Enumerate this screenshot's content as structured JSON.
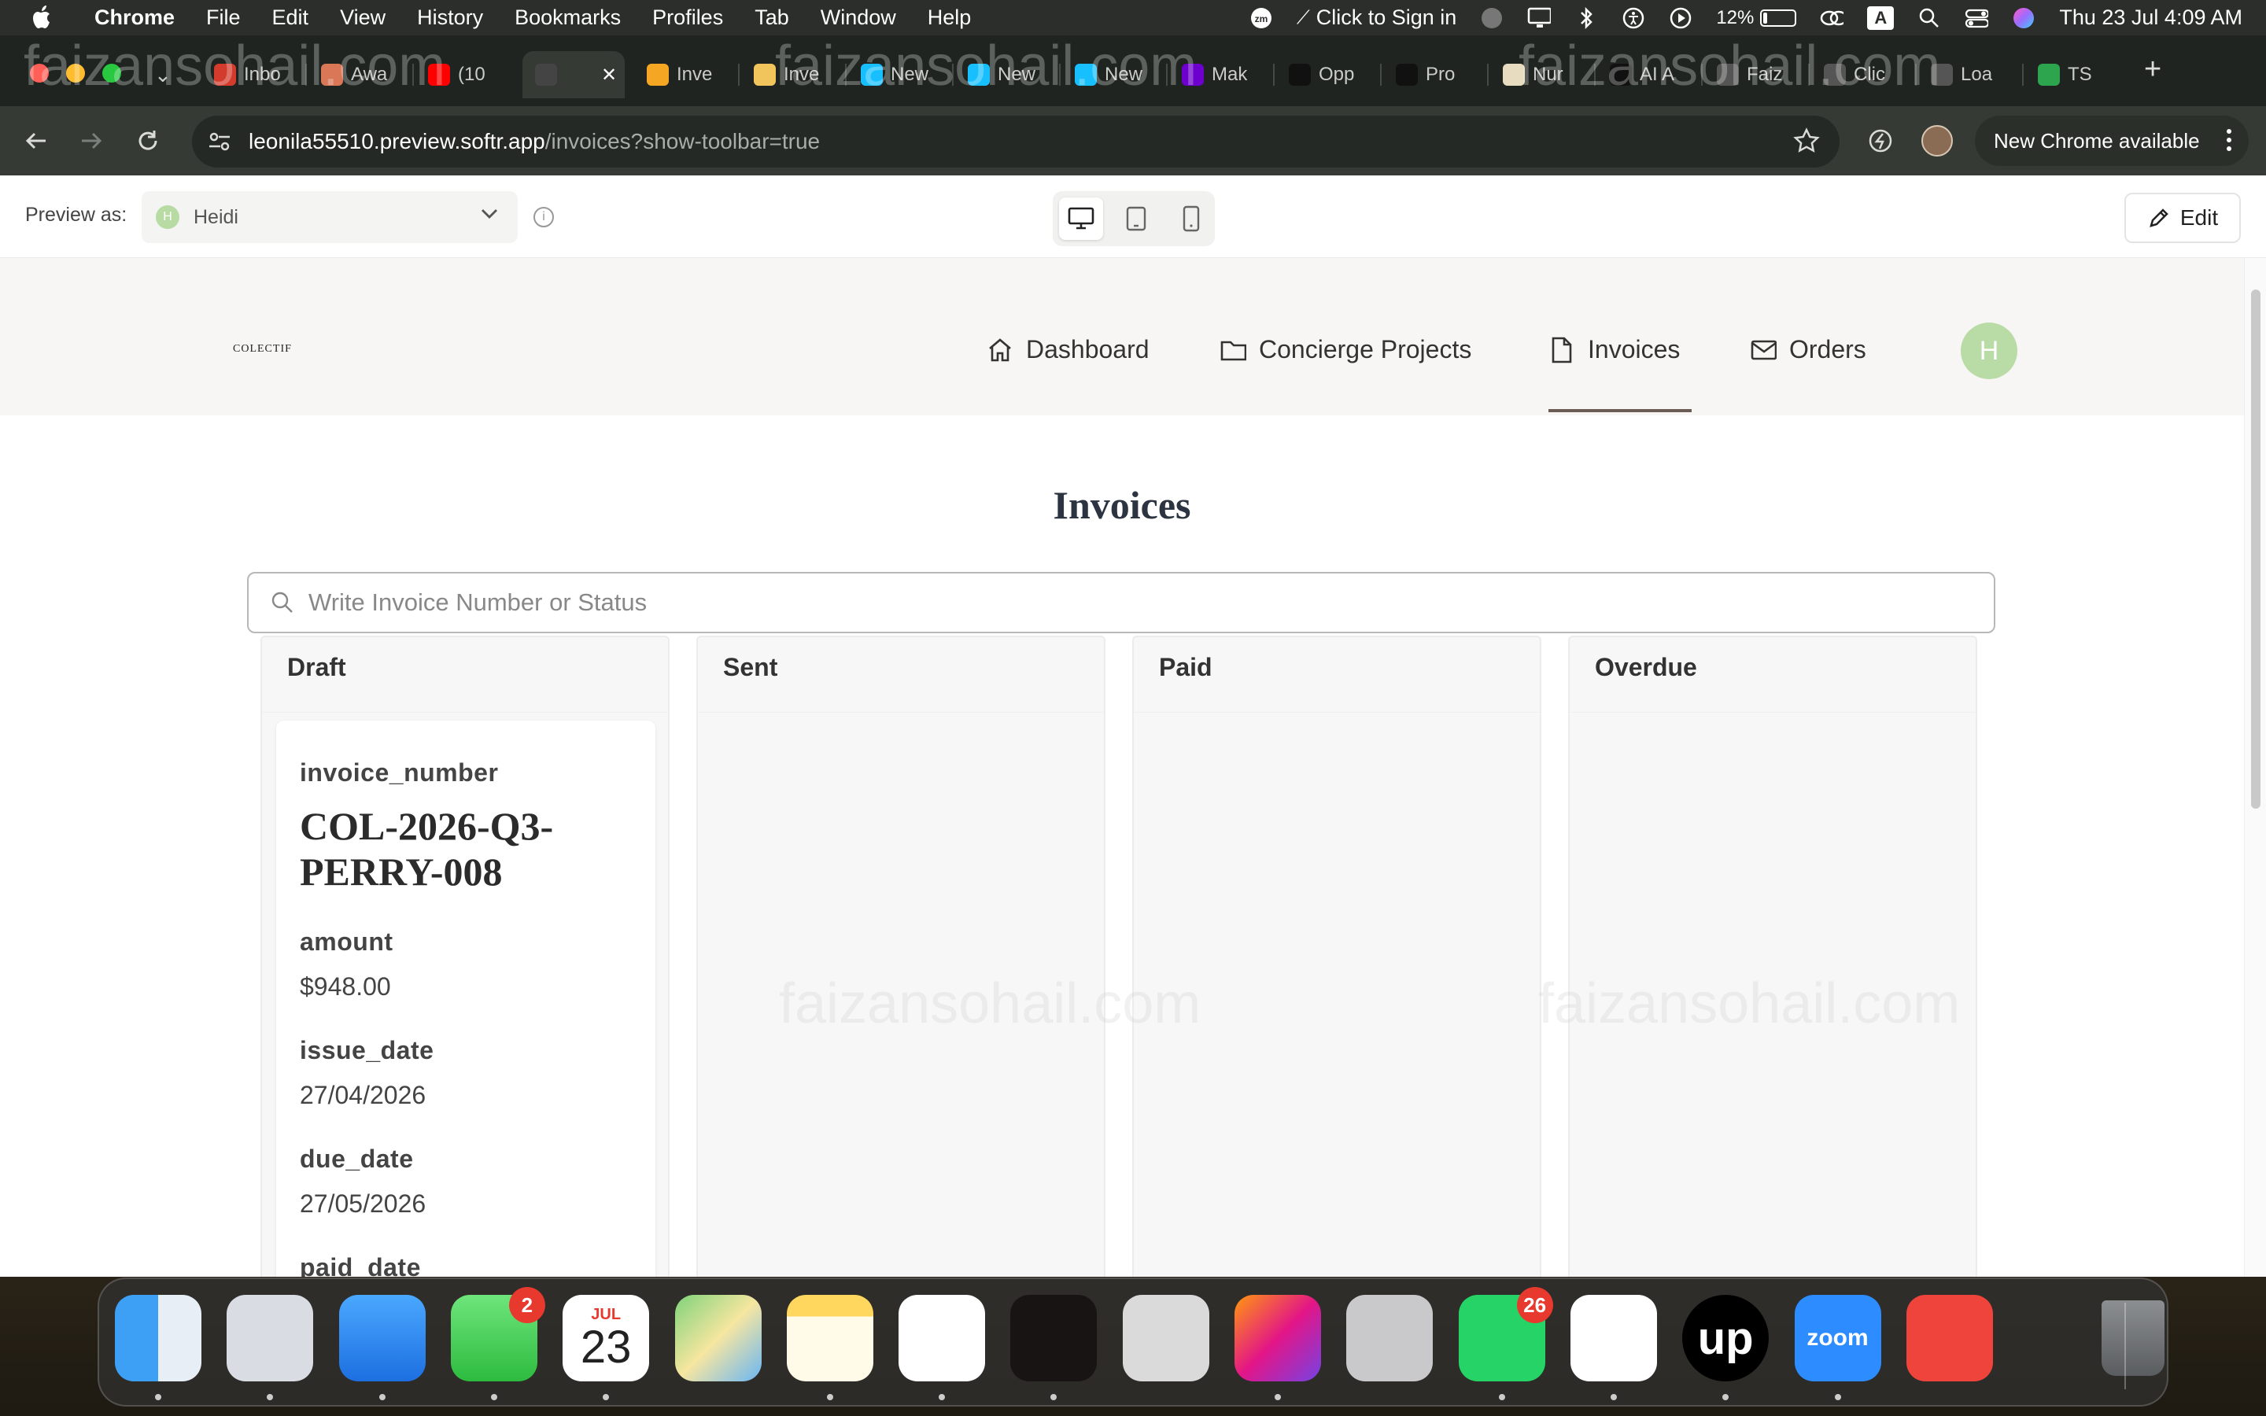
{
  "menubar": {
    "app_name": "Chrome",
    "menu_items": [
      "File",
      "Edit",
      "View",
      "History",
      "Bookmarks",
      "Profiles",
      "Tab",
      "Window",
      "Help"
    ],
    "sign_in_text": "Click to Sign in",
    "battery_percent": "12%",
    "battery_level": 0.12,
    "input_source": "A",
    "datetime": "Thu 23 Jul  4:09 AM"
  },
  "browser": {
    "tabs": [
      {
        "label": "Inbo",
        "icon": "gmail-icon",
        "color": "#d33b2c"
      },
      {
        "label": "Awa",
        "icon": "claude-icon",
        "color": "#d97757"
      },
      {
        "label": "(10",
        "icon": "youtube-icon",
        "color": "#ff0000"
      },
      {
        "label": "",
        "icon": "softr-icon",
        "color": "#444"
      },
      {
        "label": "Inve",
        "icon": "softr-icon",
        "color": "#f5a623"
      },
      {
        "label": "Inve",
        "icon": "airtable-icon",
        "color": "#f2c55c"
      },
      {
        "label": "New",
        "icon": "airtable-icon",
        "color": "#18bfff"
      },
      {
        "label": "New",
        "icon": "airtable-icon",
        "color": "#18bfff"
      },
      {
        "label": "New",
        "icon": "airtable-icon",
        "color": "#18bfff"
      },
      {
        "label": "Mak",
        "icon": "make-icon",
        "color": "#6d00cc"
      },
      {
        "label": "Opp",
        "icon": "upwork-icon",
        "color": "#111"
      },
      {
        "label": "Pro",
        "icon": "upwork-icon",
        "color": "#111"
      },
      {
        "label": "Nur",
        "icon": "nurture-icon",
        "color": "#e8dcc0"
      },
      {
        "label": "AI A",
        "icon": "upwork-icon",
        "color": "#111"
      },
      {
        "label": "Faiz",
        "icon": "page-icon",
        "color": "#555"
      },
      {
        "label": "Clic",
        "icon": "page-icon",
        "color": "#555"
      },
      {
        "label": "Loa",
        "icon": "page-icon",
        "color": "#555"
      },
      {
        "label": "TS",
        "icon": "sheets-icon",
        "color": "#2da44e"
      }
    ],
    "watermark": "faizansohail.com",
    "url_host": "leonila55510.preview.softr.app",
    "url_path": "/invoices?show-toolbar=true",
    "update_chip": "New Chrome available"
  },
  "preview_toolbar": {
    "label": "Preview as:",
    "selected_user": "Heidi",
    "selected_user_initial": "H",
    "edit_label": "Edit"
  },
  "site": {
    "logo": "COLECTIF",
    "nav": [
      {
        "label": "Dashboard",
        "icon": "home-icon"
      },
      {
        "label": "Concierge Projects",
        "icon": "folder-icon"
      },
      {
        "label": "Invoices",
        "icon": "file-icon"
      },
      {
        "label": "Orders",
        "icon": "mail-icon"
      }
    ],
    "active_nav": "Invoices",
    "avatar_initial": "H"
  },
  "page": {
    "title": "Invoices",
    "search_placeholder": "Write Invoice Number or Status",
    "columns": [
      "Draft",
      "Sent",
      "Paid",
      "Overdue"
    ],
    "card": {
      "invoice_number_label": "invoice_number",
      "invoice_number": "COL-2026-Q3-PERRY-008",
      "invoice_number_line1": "COL-2026-Q3-",
      "invoice_number_line2": "PERRY-008",
      "amount_label": "amount",
      "amount": "$948.00",
      "issue_date_label": "issue_date",
      "issue_date": "27/04/2026",
      "due_date_label": "due_date",
      "due_date": "27/05/2026",
      "paid_date_label": "paid_date"
    }
  },
  "dock": {
    "apps": [
      {
        "name": "finder",
        "badge": ""
      },
      {
        "name": "launchpad",
        "badge": ""
      },
      {
        "name": "mail",
        "badge": ""
      },
      {
        "name": "messages",
        "badge": "2"
      },
      {
        "name": "calendar",
        "badge": "",
        "month": "JUL",
        "day": "23"
      },
      {
        "name": "maps",
        "badge": ""
      },
      {
        "name": "notes",
        "badge": ""
      },
      {
        "name": "chrome",
        "badge": ""
      },
      {
        "name": "spotify",
        "badge": ""
      },
      {
        "name": "calculator",
        "badge": ""
      },
      {
        "name": "firefox",
        "badge": ""
      },
      {
        "name": "iphone-mirroring",
        "badge": ""
      },
      {
        "name": "whatsapp",
        "badge": "26"
      },
      {
        "name": "slack",
        "badge": ""
      },
      {
        "name": "upwork",
        "badge": "",
        "text": "up"
      },
      {
        "name": "zoom",
        "badge": "",
        "text": "zoom"
      },
      {
        "name": "anydesk",
        "badge": ""
      },
      {
        "name": "trash",
        "badge": ""
      }
    ]
  }
}
